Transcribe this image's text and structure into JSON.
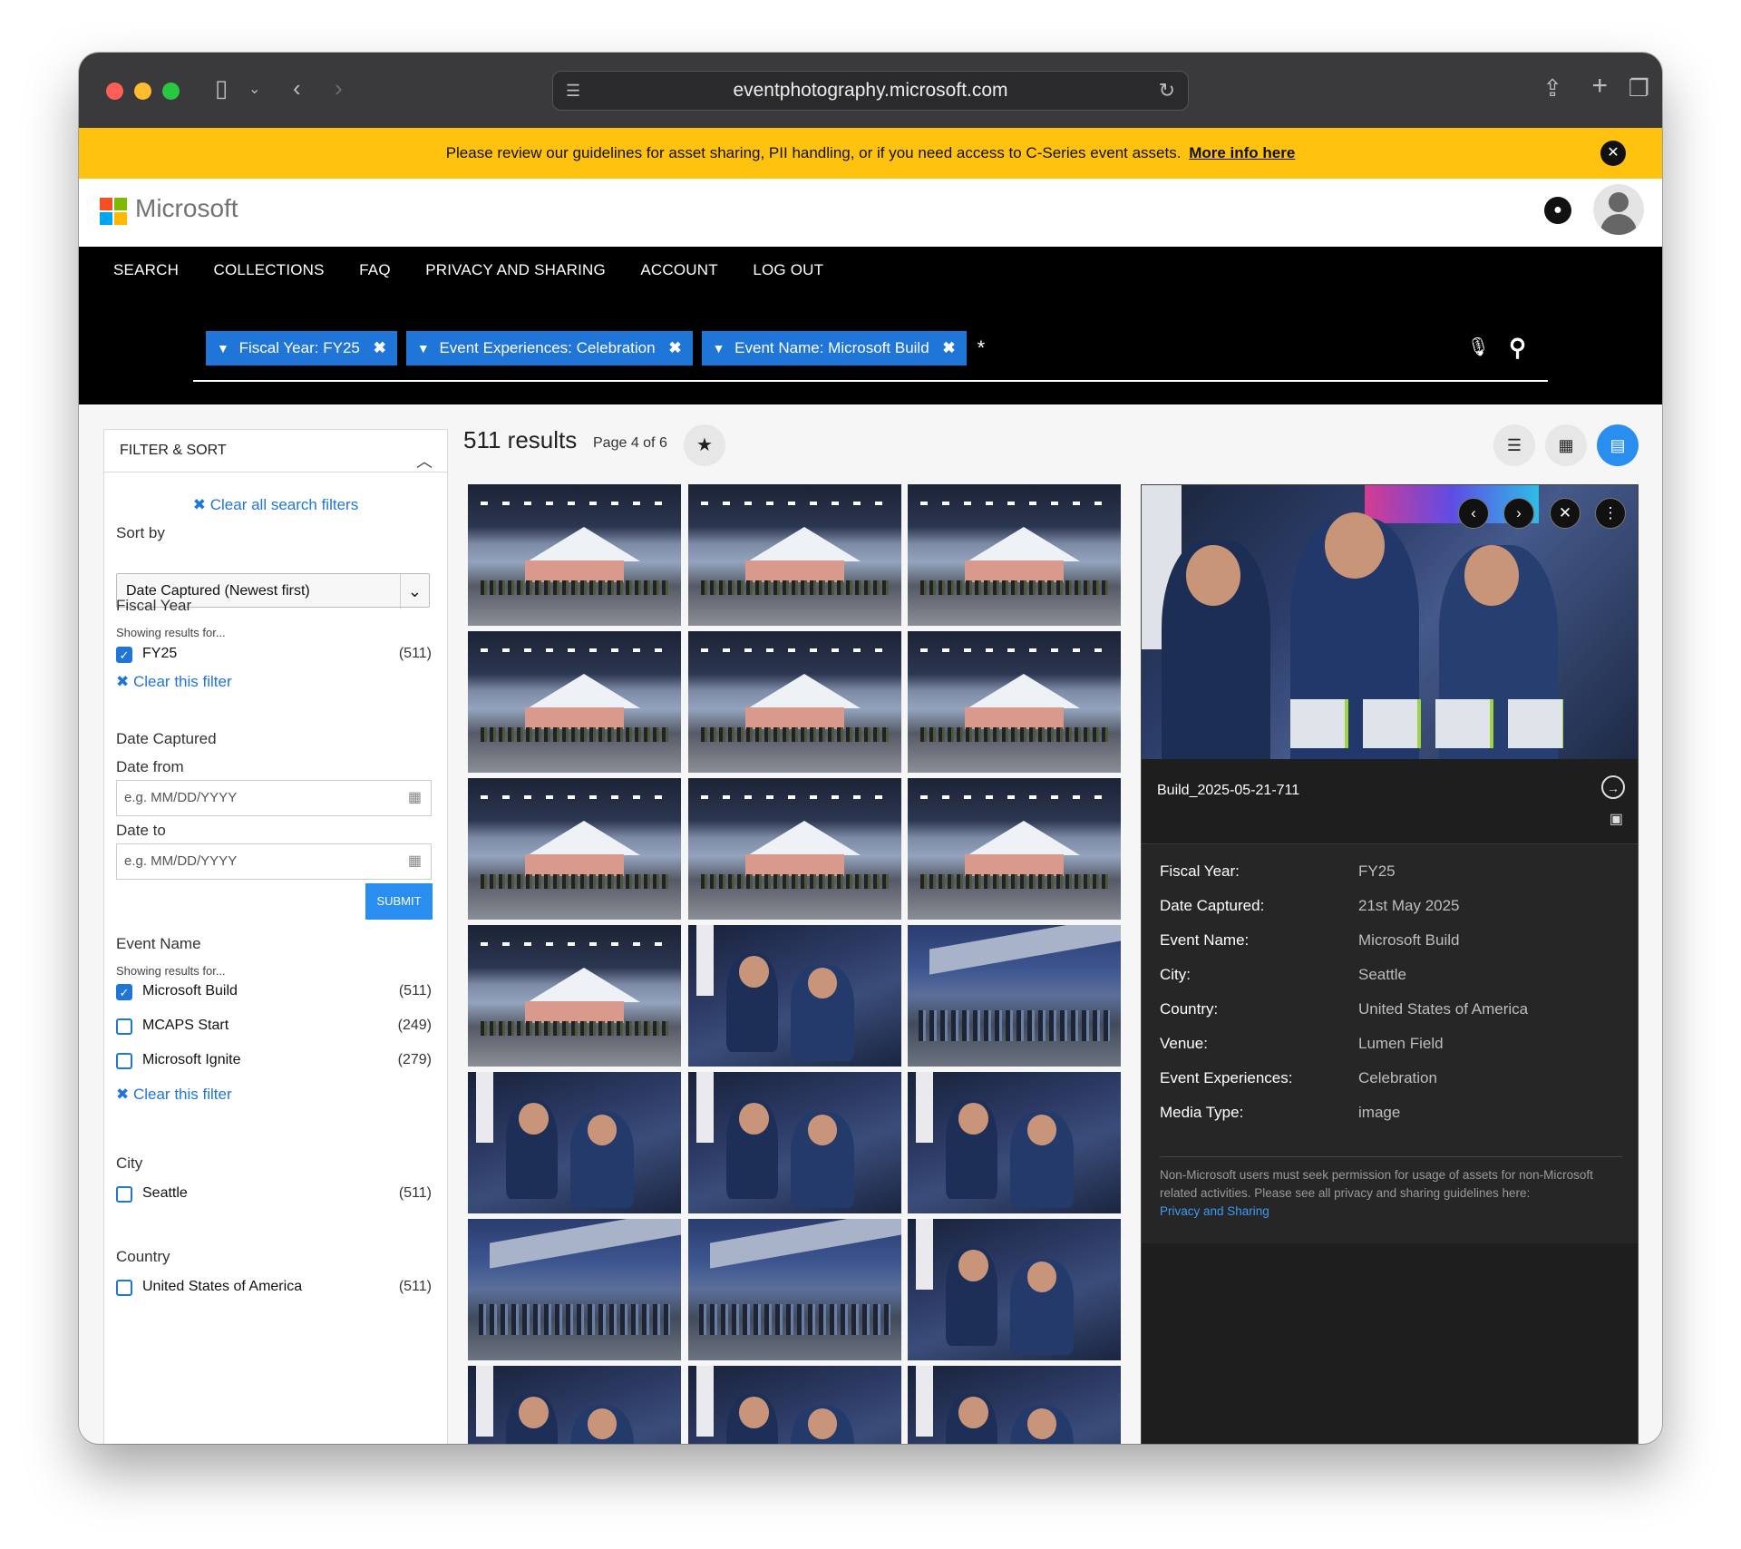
{
  "browser": {
    "url": "eventphotography.microsoft.com"
  },
  "banner": {
    "text": "Please review our guidelines for asset sharing, PII handling, or if you need access to C-Series event assets.",
    "link": "More info here"
  },
  "header": {
    "brand": "Microsoft"
  },
  "nav": {
    "items": [
      "SEARCH",
      "COLLECTIONS",
      "FAQ",
      "PRIVACY AND SHARING",
      "ACCOUNT",
      "LOG OUT"
    ]
  },
  "search": {
    "chips": [
      {
        "label": "Fiscal Year:",
        "value": "FY25"
      },
      {
        "label": "Event Experiences:",
        "value": "Celebration"
      },
      {
        "label": "Event Name:",
        "value": "Microsoft Build"
      }
    ],
    "query": "*"
  },
  "filter": {
    "title": "FILTER & SORT",
    "clear_all": "Clear all search filters",
    "sort_label": "Sort by",
    "sort_value": "Date Captured (Newest first)",
    "fiscal_year": {
      "title": "Fiscal Year",
      "showing": "Showing results for...",
      "options": [
        {
          "label": "FY25",
          "count": "(511)",
          "checked": true
        }
      ],
      "clear": "Clear this filter"
    },
    "date_captured": {
      "title": "Date Captured",
      "from_label": "Date from",
      "from_placeholder": "e.g. MM/DD/YYYY",
      "to_label": "Date to",
      "to_placeholder": "e.g. MM/DD/YYYY",
      "submit": "SUBMIT"
    },
    "event_name": {
      "title": "Event Name",
      "showing": "Showing results for...",
      "options": [
        {
          "label": "Microsoft Build",
          "count": "(511)",
          "checked": true
        },
        {
          "label": "MCAPS Start",
          "count": "(249)",
          "checked": false
        },
        {
          "label": "Microsoft Ignite",
          "count": "(279)",
          "checked": false
        }
      ],
      "clear": "Clear this filter"
    },
    "city": {
      "title": "City",
      "options": [
        {
          "label": "Seattle",
          "count": "(511)",
          "checked": false
        }
      ]
    },
    "country": {
      "title": "Country",
      "options": [
        {
          "label": "United States of America",
          "count": "(511)",
          "checked": false
        }
      ]
    }
  },
  "results": {
    "count": "511 results",
    "page": "Page 4 of 6"
  },
  "thumbnails": [
    "tent",
    "tent",
    "tent",
    "tent",
    "tent",
    "tent",
    "tent",
    "tent",
    "tent",
    "tent",
    "drum",
    "stadium",
    "drum",
    "drum",
    "drum",
    "stadium",
    "stadium",
    "drum",
    "drum",
    "drum",
    "drum"
  ],
  "detail": {
    "filename": "Build_2025-05-21-711",
    "fields": [
      {
        "k": "Fiscal Year:",
        "v": "FY25"
      },
      {
        "k": "Date Captured:",
        "v": "21st May 2025"
      },
      {
        "k": "Event Name:",
        "v": "Microsoft Build"
      },
      {
        "k": "City:",
        "v": "Seattle"
      },
      {
        "k": "Country:",
        "v": "United States of America"
      },
      {
        "k": "Venue:",
        "v": "Lumen Field"
      },
      {
        "k": "Event Experiences:",
        "v": "Celebration"
      },
      {
        "k": "Media Type:",
        "v": "image"
      }
    ],
    "note": "Non-Microsoft users must seek permission for usage of assets for non-Microsoft related activities. Please see all privacy and sharing guidelines here:",
    "note_link": "Privacy and Sharing"
  },
  "icons": {
    "search": "search-icon",
    "mic": "microphone-icon",
    "bell": "notification-bell-icon",
    "star": "star-icon",
    "close": "close-icon"
  },
  "colors": {
    "banner": "#ffc20e",
    "accent": "#1f75d8",
    "nav": "#000000"
  }
}
